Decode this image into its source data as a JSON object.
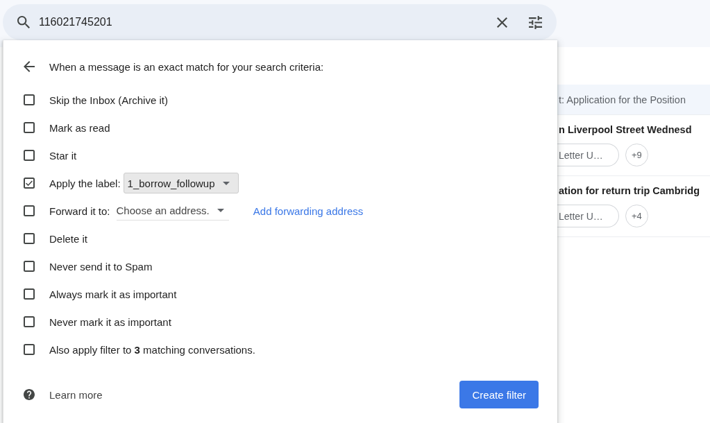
{
  "search": {
    "value": "116021745201"
  },
  "mail_list": {
    "threads": [
      {
        "subject": "t: Application for the Position",
        "read": true
      },
      {
        "subject": "n Liverpool Street Wednesd",
        "read": false,
        "chips": [
          {
            "kind": "label",
            "label": "Letter U…"
          },
          {
            "kind": "count",
            "label": "+9"
          }
        ]
      },
      {
        "subject": "ation for return trip Cambridg",
        "read": false,
        "chips": [
          {
            "kind": "label",
            "label": "Letter U…"
          },
          {
            "kind": "count",
            "label": "+4"
          }
        ]
      }
    ]
  },
  "filter_panel": {
    "heading": "When a message is an exact match for your search criteria:",
    "options": [
      {
        "kind": "checkbox",
        "label": "Skip the Inbox (Archive it)",
        "checked": false
      },
      {
        "kind": "checkbox",
        "label": "Mark as read",
        "checked": false
      },
      {
        "kind": "checkbox",
        "label": "Star it",
        "checked": false
      },
      {
        "kind": "label_select",
        "label": "Apply the label:",
        "checked": true,
        "value": "1_borrow_followup"
      },
      {
        "kind": "forward_select",
        "label": "Forward it to:",
        "checked": false,
        "placeholder": "Choose an address.",
        "link": "Add forwarding address"
      },
      {
        "kind": "checkbox",
        "label": "Delete it",
        "checked": false
      },
      {
        "kind": "checkbox",
        "label": "Never send it to Spam",
        "checked": false
      },
      {
        "kind": "checkbox",
        "label": "Always mark it as important",
        "checked": false
      },
      {
        "kind": "checkbox",
        "label": "Never mark it as important",
        "checked": false
      },
      {
        "kind": "checkbox",
        "label": "Also apply filter to **3** matching conversations.",
        "checked": false
      }
    ],
    "learn_more": "Learn more",
    "create_button": "Create filter"
  }
}
